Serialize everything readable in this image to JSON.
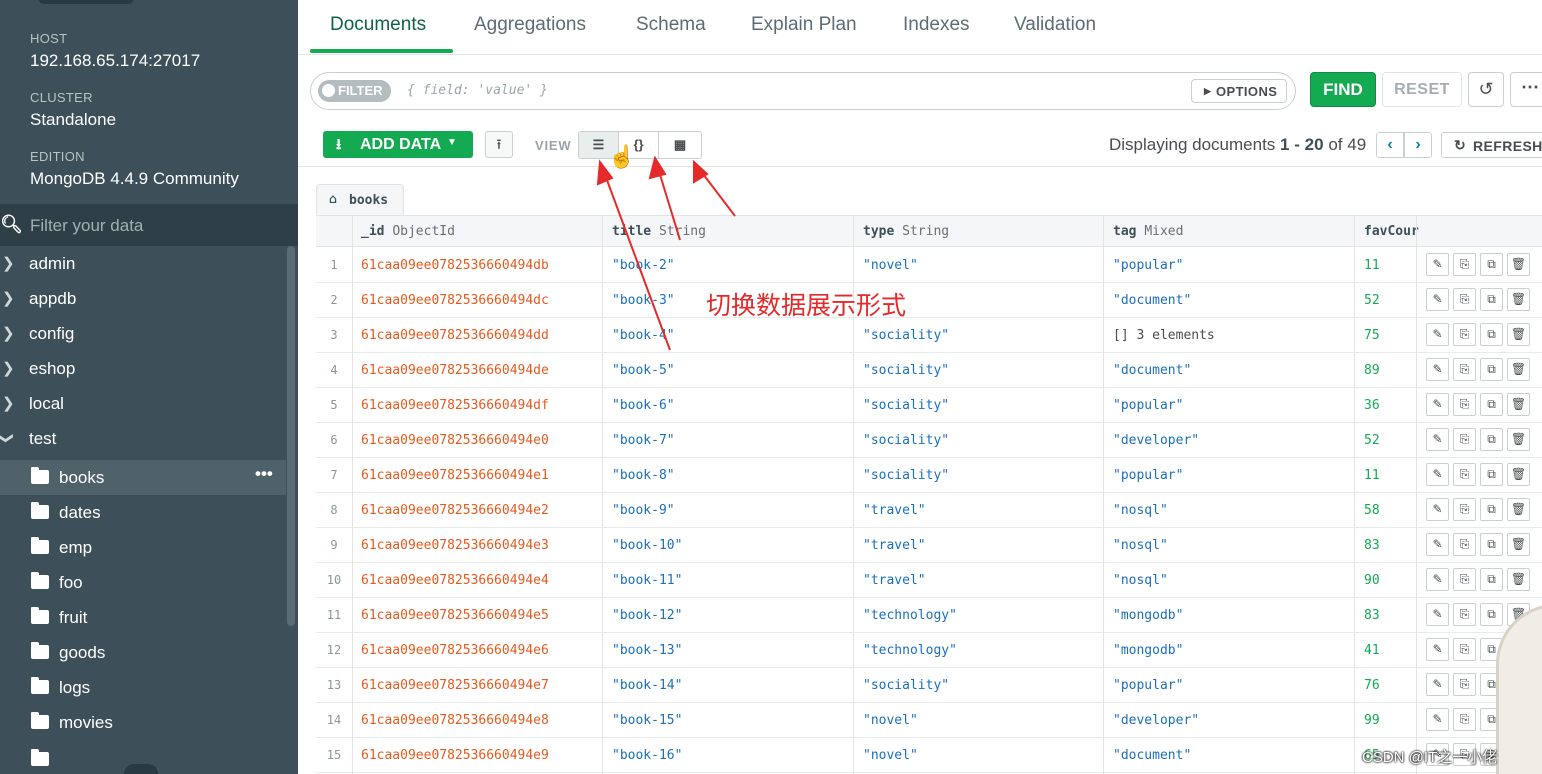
{
  "sidebar": {
    "host_label": "HOST",
    "host_value": "192.168.65.174:27017",
    "cluster_label": "CLUSTER",
    "cluster_value": "Standalone",
    "edition_label": "EDITION",
    "edition_value": "MongoDB 4.4.9 Community",
    "filter_placeholder": "Filter your data",
    "databases": [
      {
        "name": "admin",
        "expanded": false
      },
      {
        "name": "appdb",
        "expanded": false
      },
      {
        "name": "config",
        "expanded": false
      },
      {
        "name": "eshop",
        "expanded": false
      },
      {
        "name": "local",
        "expanded": false
      },
      {
        "name": "test",
        "expanded": true
      }
    ],
    "collections": [
      "books",
      "dates",
      "emp",
      "foo",
      "fruit",
      "goods",
      "logs",
      "movies"
    ],
    "active_collection": "books",
    "more_glyph": "•••"
  },
  "tabs": [
    "Documents",
    "Aggregations",
    "Schema",
    "Explain Plan",
    "Indexes",
    "Validation"
  ],
  "active_tab": "Documents",
  "query": {
    "filter_badge": "FILTER",
    "filter_placeholder": "{ field: 'value' }",
    "options_label": "OPTIONS",
    "find_label": "FIND",
    "reset_label": "RESET"
  },
  "toolbar": {
    "add_data_label": "ADD DATA",
    "view_label": "VIEW",
    "view_modes": [
      "list",
      "json",
      "table"
    ],
    "active_view": "list",
    "view_json_glyph": "{}",
    "display_prefix": "Displaying documents",
    "display_start": "1",
    "display_sep": "-",
    "display_end": "20",
    "display_of": "of",
    "display_total": "49",
    "refresh_label": "REFRESH"
  },
  "collection_tab": "books",
  "columns": [
    {
      "name": "_id",
      "type": "ObjectId"
    },
    {
      "name": "title",
      "type": "String"
    },
    {
      "name": "type",
      "type": "String"
    },
    {
      "name": "tag",
      "type": "Mixed"
    },
    {
      "name": "favCour",
      "type": ""
    }
  ],
  "rows": [
    {
      "n": "1",
      "id": "61caa09ee0782536660494db",
      "title": "\"book-2\"",
      "type": "\"novel\"",
      "tag": "\"popular\"",
      "fav": "11"
    },
    {
      "n": "2",
      "id": "61caa09ee0782536660494dc",
      "title": "\"book-3\"",
      "type": "",
      "tag": "\"document\"",
      "fav": "52"
    },
    {
      "n": "3",
      "id": "61caa09ee0782536660494dd",
      "title": "\"book-4\"",
      "type": "\"sociality\"",
      "tag": "[] 3 elements",
      "fav": "75"
    },
    {
      "n": "4",
      "id": "61caa09ee0782536660494de",
      "title": "\"book-5\"",
      "type": "\"sociality\"",
      "tag": "\"document\"",
      "fav": "89"
    },
    {
      "n": "5",
      "id": "61caa09ee0782536660494df",
      "title": "\"book-6\"",
      "type": "\"sociality\"",
      "tag": "\"popular\"",
      "fav": "36"
    },
    {
      "n": "6",
      "id": "61caa09ee0782536660494e0",
      "title": "\"book-7\"",
      "type": "\"sociality\"",
      "tag": "\"developer\"",
      "fav": "52"
    },
    {
      "n": "7",
      "id": "61caa09ee0782536660494e1",
      "title": "\"book-8\"",
      "type": "\"sociality\"",
      "tag": "\"popular\"",
      "fav": "11"
    },
    {
      "n": "8",
      "id": "61caa09ee0782536660494e2",
      "title": "\"book-9\"",
      "type": "\"travel\"",
      "tag": "\"nosql\"",
      "fav": "58"
    },
    {
      "n": "9",
      "id": "61caa09ee0782536660494e3",
      "title": "\"book-10\"",
      "type": "\"travel\"",
      "tag": "\"nosql\"",
      "fav": "83"
    },
    {
      "n": "10",
      "id": "61caa09ee0782536660494e4",
      "title": "\"book-11\"",
      "type": "\"travel\"",
      "tag": "\"nosql\"",
      "fav": "90"
    },
    {
      "n": "11",
      "id": "61caa09ee0782536660494e5",
      "title": "\"book-12\"",
      "type": "\"technology\"",
      "tag": "\"mongodb\"",
      "fav": "83"
    },
    {
      "n": "12",
      "id": "61caa09ee0782536660494e6",
      "title": "\"book-13\"",
      "type": "\"technology\"",
      "tag": "\"mongodb\"",
      "fav": "41"
    },
    {
      "n": "13",
      "id": "61caa09ee0782536660494e7",
      "title": "\"book-14\"",
      "type": "\"sociality\"",
      "tag": "\"popular\"",
      "fav": "76"
    },
    {
      "n": "14",
      "id": "61caa09ee0782536660494e8",
      "title": "\"book-15\"",
      "type": "\"novel\"",
      "tag": "\"developer\"",
      "fav": "99"
    },
    {
      "n": "15",
      "id": "61caa09ee0782536660494e9",
      "title": "\"book-16\"",
      "type": "\"novel\"",
      "tag": "\"document\"",
      "fav": "65"
    }
  ],
  "row_action_icons": [
    "edit-icon",
    "copy-icon",
    "clone-icon",
    "delete-icon"
  ],
  "overlay": {
    "annotation": "切换数据展示形式",
    "watermark": "CSDN @IT之一小佬"
  },
  "colors": {
    "sidebar_bg": "#3d4f58",
    "accent_green": "#13aa52",
    "id_orange": "#e55b1f",
    "string_blue": "#1a6fbd",
    "annotation_red": "#e52a2a"
  }
}
